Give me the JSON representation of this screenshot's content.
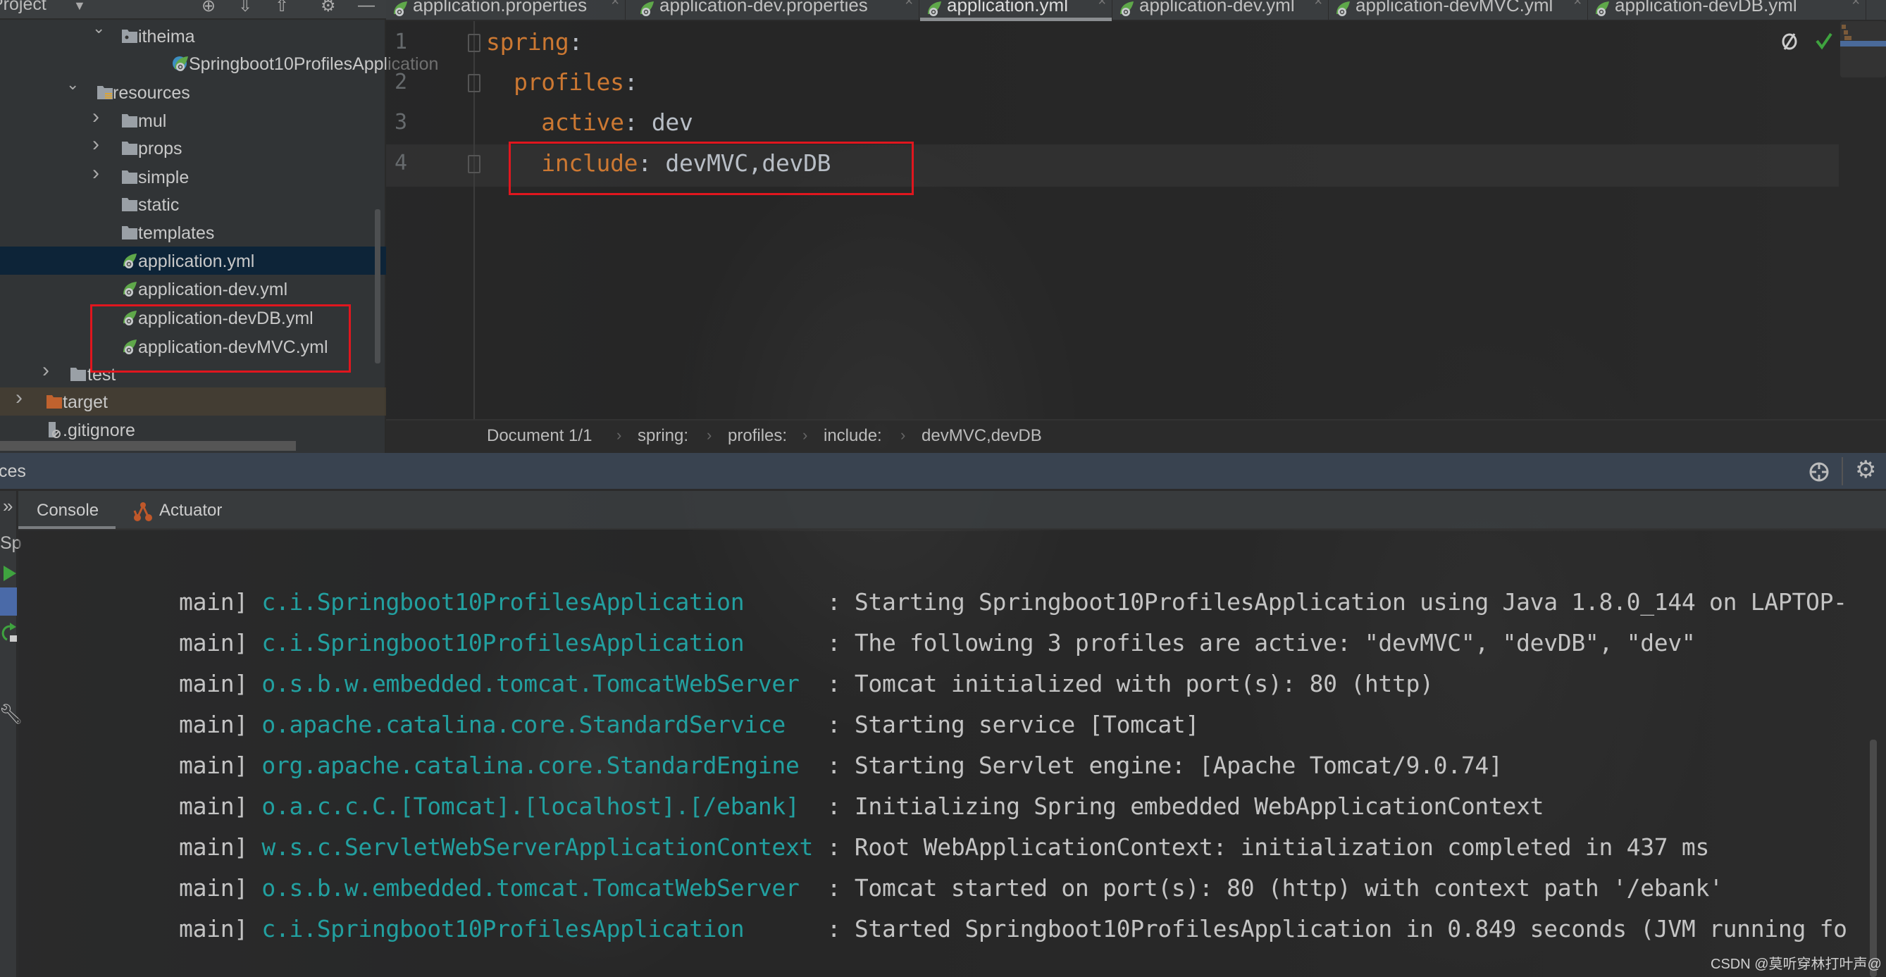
{
  "project_panel": {
    "title": "Project",
    "tree": [
      {
        "label": "itheima",
        "type": "package",
        "indent": 3,
        "expanded": true
      },
      {
        "label": "Springboot10ProfilesApplication",
        "type": "spring-class",
        "indent": 4
      },
      {
        "label": "resources",
        "type": "resources-folder",
        "indent": 2,
        "expanded": true
      },
      {
        "label": "mul",
        "type": "folder",
        "indent": 3,
        "expanded": false
      },
      {
        "label": "props",
        "type": "folder",
        "indent": 3,
        "expanded": false
      },
      {
        "label": "simple",
        "type": "folder",
        "indent": 3,
        "expanded": false
      },
      {
        "label": "static",
        "type": "folder",
        "indent": 3
      },
      {
        "label": "templates",
        "type": "folder",
        "indent": 3
      },
      {
        "label": "application.yml",
        "type": "yml",
        "indent": 3,
        "selected": true
      },
      {
        "label": "application-dev.yml",
        "type": "yml",
        "indent": 3
      },
      {
        "label": "application-devDB.yml",
        "type": "yml",
        "indent": 3
      },
      {
        "label": "application-devMVC.yml",
        "type": "yml",
        "indent": 3
      },
      {
        "label": "test",
        "type": "folder",
        "indent": 1,
        "expanded": false
      },
      {
        "label": "target",
        "type": "target-folder",
        "indent": 0,
        "expanded": false
      },
      {
        "label": ".gitignore",
        "type": "gitignore",
        "indent": 0
      }
    ]
  },
  "editor_tabs": [
    {
      "label": "application.properties"
    },
    {
      "label": "application-dev.properties"
    },
    {
      "label": "application.yml",
      "active": true
    },
    {
      "label": "application-dev.yml"
    },
    {
      "label": "application-devMVC.yml"
    },
    {
      "label": "application-devDB.yml"
    }
  ],
  "editor": {
    "lines": [
      {
        "num": "1",
        "indent": "",
        "key": "spring",
        "sep": ":",
        "value": ""
      },
      {
        "num": "2",
        "indent": "  ",
        "key": "profiles",
        "sep": ":",
        "value": ""
      },
      {
        "num": "3",
        "indent": "    ",
        "key": "active",
        "sep": ": ",
        "value": "dev"
      },
      {
        "num": "4",
        "indent": "    ",
        "key": "include",
        "sep": ": ",
        "value": "devMVC,devDB"
      }
    ],
    "inspection_icons": [
      "eye-slash-icon",
      "check-icon"
    ]
  },
  "breadcrumb": [
    "Document 1/1",
    "spring:",
    "profiles:",
    "include:",
    "devMVC,devDB"
  ],
  "services": {
    "title": "ces",
    "tabs": [
      {
        "label": "Console",
        "active": true
      },
      {
        "label": "Actuator"
      }
    ],
    "more_label": "»",
    "run_config_label": "Sp"
  },
  "console": {
    "lines": [
      {
        "thread": "main]",
        "logger": "c.i.Springboot10ProfilesApplication",
        "message": "Starting Springboot10ProfilesApplication using Java 1.8.0_144 on LAPTOP-"
      },
      {
        "thread": "main]",
        "logger": "c.i.Springboot10ProfilesApplication",
        "message": "The following 3 profiles are active: \"devMVC\", \"devDB\", \"dev\""
      },
      {
        "thread": "main]",
        "logger": "o.s.b.w.embedded.tomcat.TomcatWebServer",
        "message": "Tomcat initialized with port(s): 80 (http)"
      },
      {
        "thread": "main]",
        "logger": "o.apache.catalina.core.StandardService",
        "message": "Starting service [Tomcat]"
      },
      {
        "thread": "main]",
        "logger": "org.apache.catalina.core.StandardEngine",
        "message": "Starting Servlet engine: [Apache Tomcat/9.0.74]"
      },
      {
        "thread": "main]",
        "logger": "o.a.c.c.C.[Tomcat].[localhost].[/ebank]",
        "message": "Initializing Spring embedded WebApplicationContext"
      },
      {
        "thread": "main]",
        "logger": "w.s.c.ServletWebServerApplicationContext",
        "message": "Root WebApplicationContext: initialization completed in 437 ms"
      },
      {
        "thread": "main]",
        "logger": "o.s.b.w.embedded.tomcat.TomcatWebServer",
        "message": "Tomcat started on port(s): 80 (http) with context path '/ebank'"
      },
      {
        "thread": "main]",
        "logger": "c.i.Springboot10ProfilesApplication",
        "message": "Started Springboot10ProfilesApplication in 0.849 seconds (JVM running fo"
      }
    ]
  },
  "watermark": "CSDN @莫听穿林打叶声@",
  "colors": {
    "yaml_key": "#cc7832",
    "logger": "#22a0a0",
    "highlight_box": "#e0161e",
    "selection": "#0d2438"
  }
}
